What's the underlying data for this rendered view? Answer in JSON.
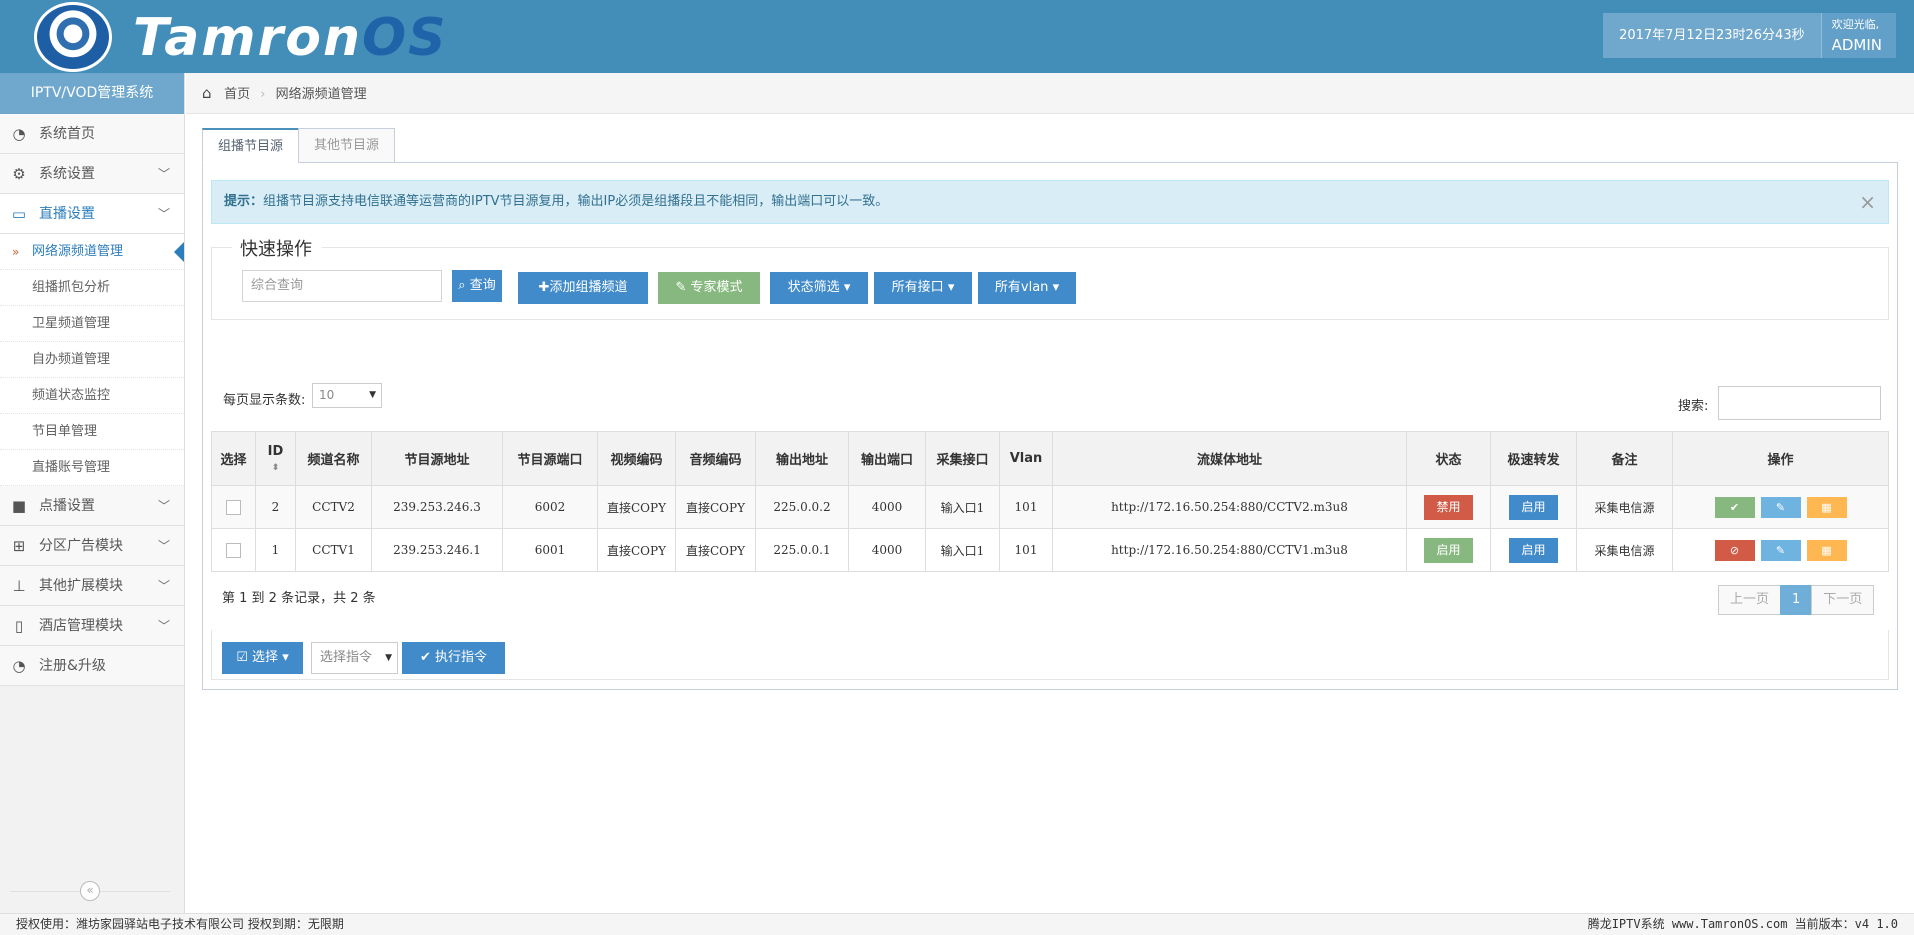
{
  "header": {
    "logo_text_a": "Tamron",
    "logo_text_b": "OS",
    "datetime": "2017年7月12日23时26分43秒",
    "welcome": "欢迎光临,",
    "user": "ADMIN"
  },
  "sidebar": {
    "title": "IPTV/VOD管理系统",
    "items": [
      {
        "label": "系统首页",
        "icon": "dashboard-icon"
      },
      {
        "label": "系统设置",
        "icon": "gears-icon"
      },
      {
        "label": "直播设置",
        "icon": "desktop-icon"
      },
      {
        "label": "点播设置",
        "icon": "video-camera-icon"
      },
      {
        "label": "分区广告模块",
        "icon": "windows-icon"
      },
      {
        "label": "其他扩展模块",
        "icon": "sitemap-icon"
      },
      {
        "label": "酒店管理模块",
        "icon": "tablet-icon"
      },
      {
        "label": "注册&升级",
        "icon": "dashboard-icon"
      }
    ],
    "sub_items": [
      "网络源频道管理",
      "组播抓包分析",
      "卫星频道管理",
      "自办频道管理",
      "频道状态监控",
      "节目单管理",
      "直播账号管理"
    ],
    "collapse_icon": "«"
  },
  "breadcrumb": {
    "home": "首页",
    "current": "网络源频道管理"
  },
  "tabs": [
    "组播节目源",
    "其他节目源"
  ],
  "alert": {
    "prefix": "提示：",
    "text": "组播节目源支持电信联通等运营商的IPTV节目源复用，输出IP必须是组播段且不能相同，输出端口可以一致。",
    "close": "×"
  },
  "quick": {
    "title": "快速操作",
    "search_placeholder": "综合查询",
    "query_btn": "查询",
    "add_btn": "添加组播频道",
    "expert_btn": "专家模式",
    "status_btn": "状态筛选",
    "iface_btn": "所有接口",
    "vlan_btn": "所有vlan"
  },
  "table_ctrl": {
    "page_len_label": "每页显示条数:",
    "page_len": "10",
    "search_label": "搜索:"
  },
  "table": {
    "headers": [
      "选择",
      "ID",
      "频道名称",
      "节目源地址",
      "节目源端口",
      "视频编码",
      "音频编码",
      "输出地址",
      "输出端口",
      "采集接口",
      "Vlan",
      "流媒体地址",
      "状态",
      "极速转发",
      "备注",
      "操作"
    ],
    "rows": [
      {
        "id": "2",
        "name": "CCTV2",
        "src": "239.253.246.3",
        "port": "6002",
        "venc": "直接COPY",
        "aenc": "直接COPY",
        "out": "225.0.0.2",
        "oport": "4000",
        "iface": "输入口1",
        "vlan": "101",
        "url": "http://172.16.50.254:880/CCTV2.m3u8",
        "status": "禁用",
        "fast": "启用",
        "remark": "采集电信源"
      },
      {
        "id": "1",
        "name": "CCTV1",
        "src": "239.253.246.1",
        "port": "6001",
        "venc": "直接COPY",
        "aenc": "直接COPY",
        "out": "225.0.0.1",
        "oport": "4000",
        "iface": "输入口1",
        "vlan": "101",
        "url": "http://172.16.50.254:880/CCTV1.m3u8",
        "status": "启用",
        "fast": "启用",
        "remark": "采集电信源"
      }
    ]
  },
  "info": "第 1 到 2 条记录，共 2 条",
  "pager": {
    "prev": "上一页",
    "current": "1",
    "next": "下一页"
  },
  "cmd": {
    "select_btn": "选择",
    "select_placeholder": "选择指令",
    "exec_btn": "执行指令"
  },
  "footer": {
    "left": "授权使用：潍坊家园驿站电子技术有限公司 授权到期：无限期",
    "right": "腾龙IPTV系统 www.TamronOS.com 当前版本：v4 1.0"
  }
}
